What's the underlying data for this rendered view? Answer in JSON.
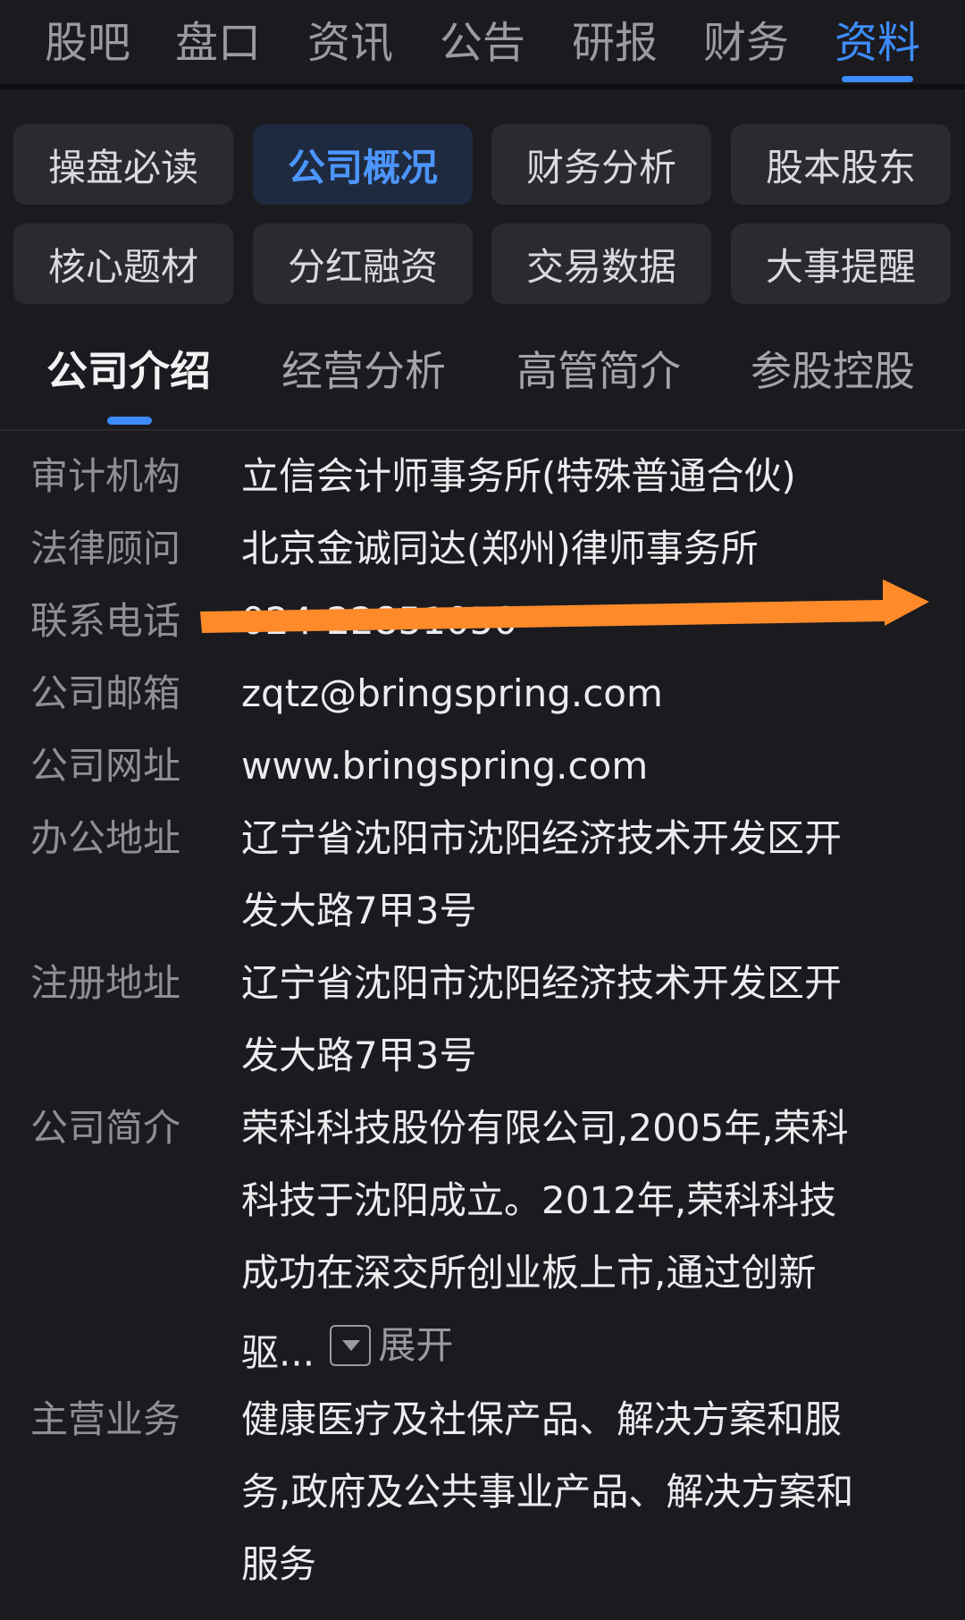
{
  "top_tabs": [
    "股吧",
    "盘口",
    "资讯",
    "公告",
    "研报",
    "财务",
    "资料"
  ],
  "chips": [
    "操盘必读",
    "公司概况",
    "财务分析",
    "股本股东",
    "核心题材",
    "分红融资",
    "交易数据",
    "大事提醒"
  ],
  "sub_tabs": [
    "公司介绍",
    "经营分析",
    "高管简介",
    "参股控股"
  ],
  "info": {
    "audit_label": "审计机构",
    "audit_value": "立信会计师事务所(特殊普通合伙)",
    "legal_label": "法律顾问",
    "legal_value": "北京金诚同达(郑州)律师事务所",
    "phone_label": "联系电话",
    "phone_value": "024-22851050",
    "email_label": "公司邮箱",
    "email_value": "zqtz@bringspring.com",
    "web_label": "公司网址",
    "web_value": "www.bringspring.com",
    "office_label": "办公地址",
    "office_line1": "辽宁省沈阳市沈阳经济技术开发区开",
    "office_line2": "发大路7甲3号",
    "reg_label": "注册地址",
    "reg_line1": "辽宁省沈阳市沈阳经济技术开发区开",
    "reg_line2": "发大路7甲3号",
    "intro_label": "公司简介",
    "intro_line1": "荣科科技股份有限公司,2005年,荣科",
    "intro_line2": "科技于沈阳成立。2012年,荣科科技",
    "intro_line3": "成功在深交所创业板上市,通过创新",
    "intro_line4": "驱...",
    "expand_label": "展开",
    "biz_label": "主营业务",
    "biz_line1": "健康医疗及社保产品、解决方案和服",
    "biz_line2": "务,政府及公共事业产品、解决方案和",
    "biz_line3": "服务"
  },
  "colors": {
    "accent": "#3d8cff",
    "arrow": "#ff8a2a",
    "background": "#1b1b1f"
  }
}
